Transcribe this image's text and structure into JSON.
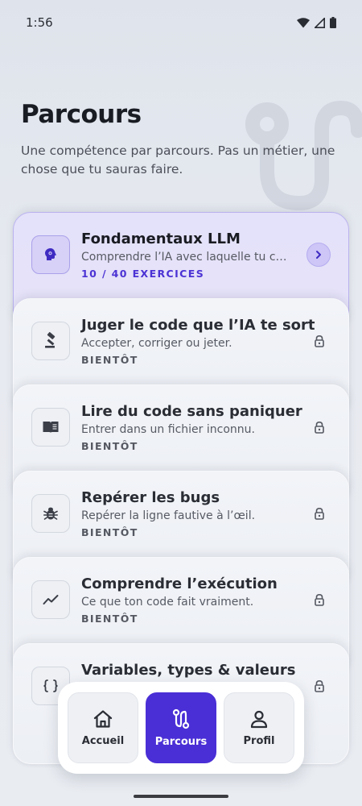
{
  "status_bar": {
    "time": "1:56"
  },
  "header": {
    "title": "Parcours",
    "subtitle": "Une compétence par parcours. Pas un métier, une chose que tu sauras faire."
  },
  "courses": [
    {
      "title": "Fondamentaux LLM",
      "description": "Comprendre l’IA avec laquelle tu c…",
      "status": "10 / 40 EXERCICES",
      "icon": "brain-gear-icon",
      "active": true
    },
    {
      "title": "Juger le code que l’IA te sort",
      "description": "Accepter, corriger ou jeter.",
      "status": "BIENTÔT",
      "icon": "gavel-icon",
      "active": false
    },
    {
      "title": "Lire du code sans paniquer",
      "description": "Entrer dans un fichier inconnu.",
      "status": "BIENTÔT",
      "icon": "book-icon",
      "active": false
    },
    {
      "title": "Repérer les bugs",
      "description": "Repérer la ligne fautive à l’œil.",
      "status": "BIENTÔT",
      "icon": "bug-icon",
      "active": false
    },
    {
      "title": "Comprendre l’exécution",
      "description": "Ce que ton code fait vraiment.",
      "status": "BIENTÔT",
      "icon": "trend-line-icon",
      "active": false
    },
    {
      "title": "Variables, types & valeurs",
      "description": "",
      "status": "",
      "icon": "braces-icon",
      "active": false
    }
  ],
  "nav": {
    "home_label": "Accueil",
    "courses_label": "Parcours",
    "profile_label": "Profil"
  },
  "colors": {
    "accent": "#4a2fd6",
    "active_card": "#e4e1fa",
    "background": "#e7eaf0"
  }
}
